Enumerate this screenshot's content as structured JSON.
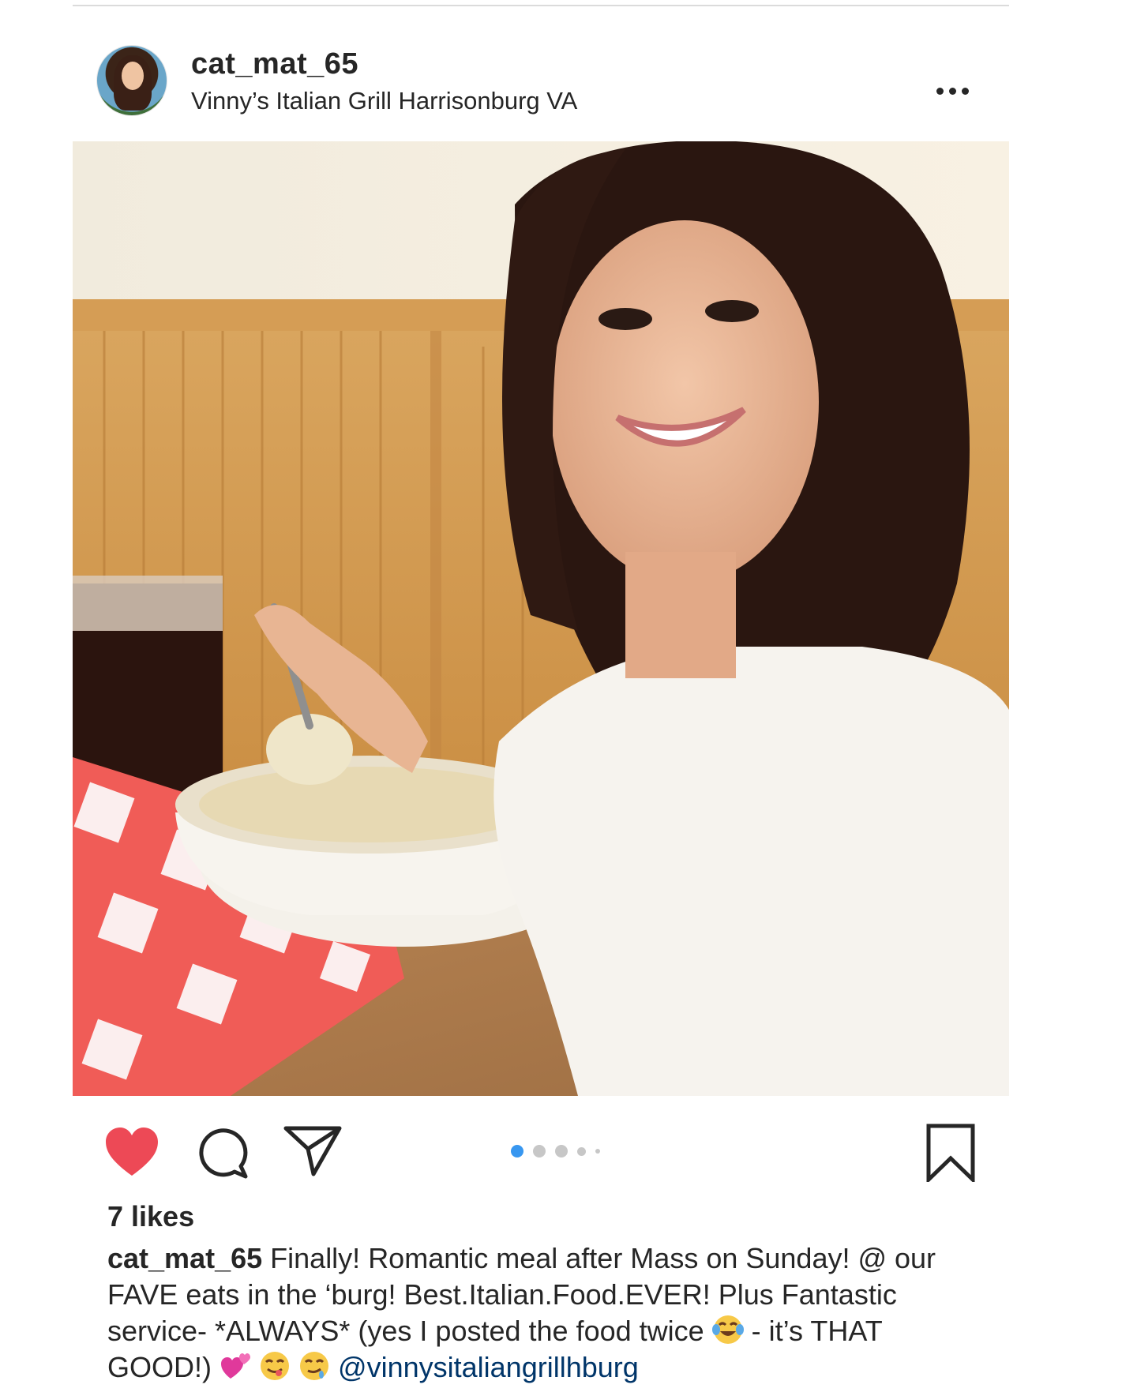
{
  "post": {
    "username": "cat_mat_65",
    "location": "Vinny’s Italian Grill Harrisonburg VA",
    "likes": "7 likes",
    "caption": {
      "username": "cat_mat_65",
      "text": "Finally! Romantic meal after Mass on Sunday! @ our FAVE eats in the ‘burg! Best.Italian.Food.EVER! Plus Fantastic service- *ALWAYS* (yes I posted the food twice ",
      "text_after_emoji": "- it’s THAT GOOD!) ",
      "mention": "@vinnysitaliangrillhburg"
    },
    "carousel": {
      "total": 5,
      "active_index": 0
    }
  },
  "icons": {
    "more": "more-options-icon",
    "like": "heart-filled-icon",
    "comment": "comment-icon",
    "share": "paper-plane-icon",
    "save": "bookmark-icon"
  },
  "colors": {
    "like": "#ed4956",
    "carousel_active": "#3897f0",
    "carousel_inactive": "#c7c7c7",
    "mention": "#003569"
  }
}
